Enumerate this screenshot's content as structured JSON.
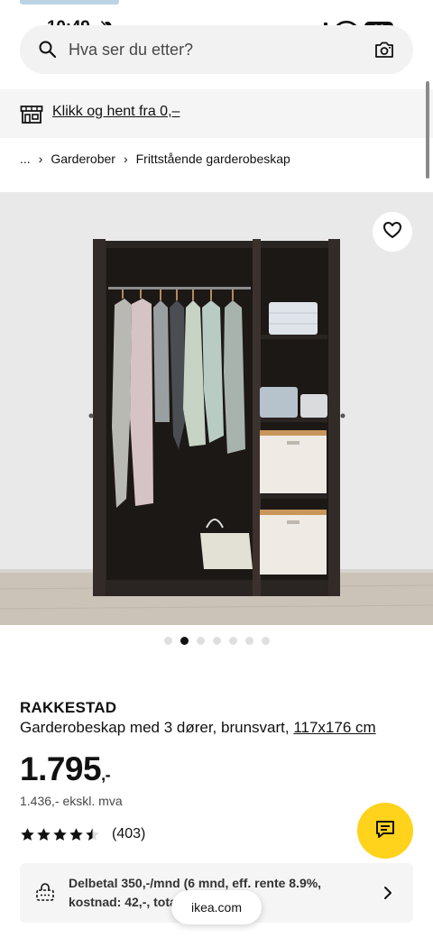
{
  "status": {
    "time": "10:49",
    "battery": "62"
  },
  "search": {
    "placeholder": "Hva ser du etter?"
  },
  "pickup": {
    "label": "Klikk og hent fra 0,–"
  },
  "breadcrumb": {
    "ellipsis": "...",
    "items": [
      "Garderober",
      "Frittstående garderobeskap"
    ]
  },
  "product": {
    "name": "RAKKESTAD",
    "description": "Garderobeskap med 3 dører, brunsvart, ",
    "dimensions": "117x176 cm",
    "price": "1.795",
    "price_suffix": ",-",
    "price_ex_vat": "1.436,- ekskl. mva",
    "rating": 4.5,
    "review_count": "(403)",
    "image_count": 7,
    "active_image": 2
  },
  "installment": {
    "text": "Delbetal 350,-/mnd (6 mnd, eff. rente 8.9%, kostnad: 42,-, totalt 1.837,-)"
  },
  "browser": {
    "url": "ikea.com"
  },
  "colors": {
    "accent": "#ffd21c",
    "text": "#111111",
    "cabinet": "#2a2422"
  },
  "icons": [
    "search-icon",
    "camera-icon",
    "store-icon",
    "heart-icon",
    "chat-icon",
    "installment-icon",
    "chevron-right-icon"
  ]
}
